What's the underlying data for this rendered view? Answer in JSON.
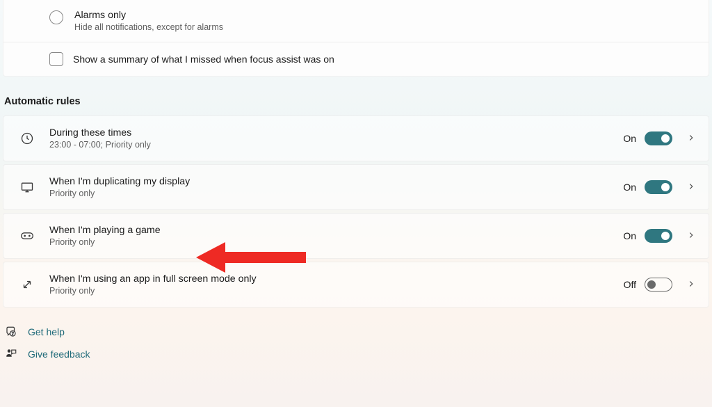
{
  "focus_options": {
    "alarms_only": {
      "title": "Alarms only",
      "subtitle": "Hide all notifications, except for alarms"
    },
    "summary_checkbox_label": "Show a summary of what I missed when focus assist was on"
  },
  "section_header": "Automatic rules",
  "rules": {
    "times": {
      "title": "During these times",
      "subtitle": "23:00 - 07:00; Priority only",
      "state_label": "On",
      "on": true
    },
    "display": {
      "title": "When I'm duplicating my display",
      "subtitle": "Priority only",
      "state_label": "On",
      "on": true
    },
    "game": {
      "title": "When I'm playing a game",
      "subtitle": "Priority only",
      "state_label": "On",
      "on": true
    },
    "fullscreen": {
      "title": "When I'm using an app in full screen mode only",
      "subtitle": "Priority only",
      "state_label": "Off",
      "on": false
    }
  },
  "footer": {
    "help": "Get help",
    "feedback": "Give feedback"
  }
}
